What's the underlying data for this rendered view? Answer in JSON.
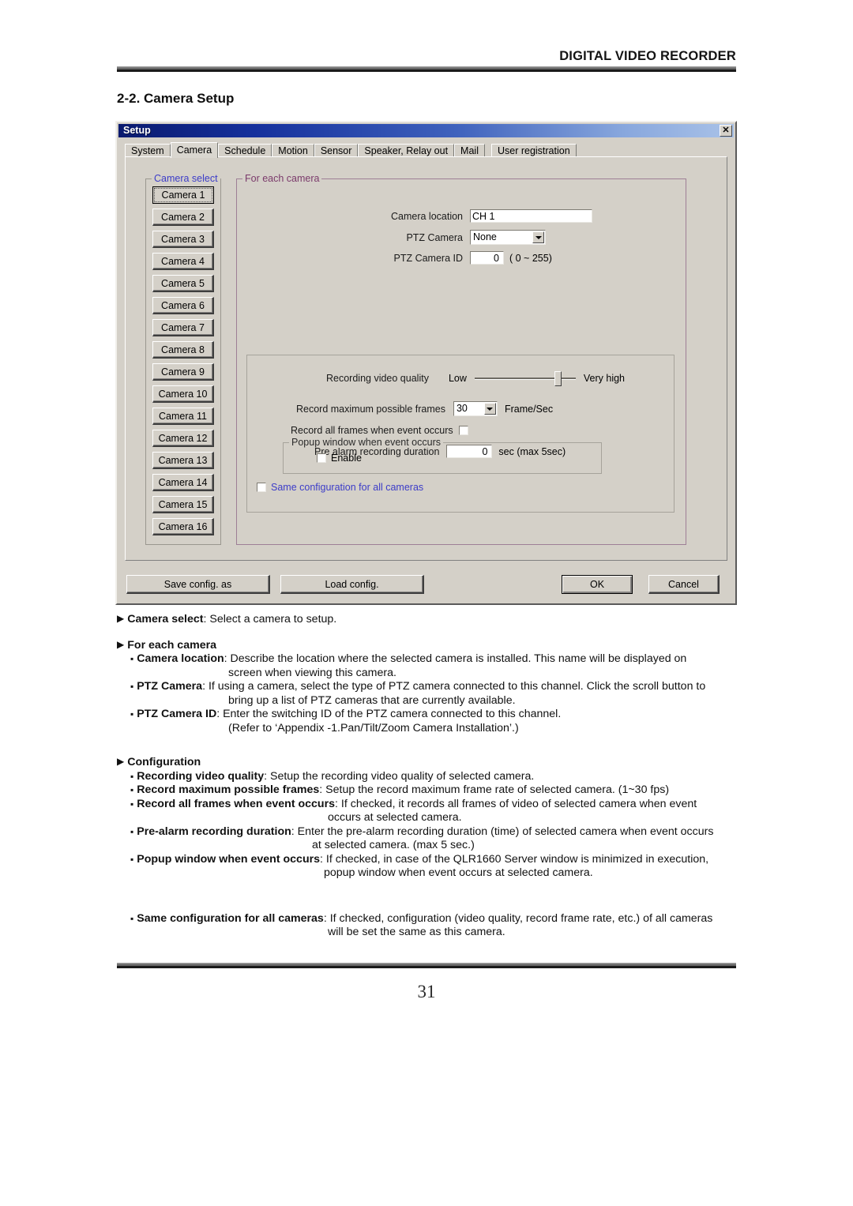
{
  "header": {
    "title": "DIGITAL VIDEO RECORDER"
  },
  "section": {
    "title": "2-2. Camera Setup"
  },
  "dialog": {
    "title": "Setup",
    "close_label": "✕",
    "tabs": [
      {
        "label": "System",
        "selected": false
      },
      {
        "label": "Camera",
        "selected": true
      },
      {
        "label": "Schedule",
        "selected": false
      },
      {
        "label": "Motion",
        "selected": false
      },
      {
        "label": "Sensor",
        "selected": false
      },
      {
        "label": "Speaker, Relay out",
        "selected": false
      },
      {
        "label": "Mail",
        "selected": false
      },
      {
        "label": "User registration",
        "selected": false
      }
    ],
    "camera_select": {
      "legend": "Camera select",
      "selected_index": 0,
      "cameras": [
        "Camera 1",
        "Camera 2",
        "Camera 3",
        "Camera 4",
        "Camera 5",
        "Camera 6",
        "Camera 7",
        "Camera 8",
        "Camera 9",
        "Camera 10",
        "Camera 11",
        "Camera 12",
        "Camera 13",
        "Camera 14",
        "Camera 15",
        "Camera 16"
      ]
    },
    "for_each_camera": {
      "legend": "For each camera",
      "camera_location_label": "Camera location",
      "camera_location_value": "CH 1",
      "ptz_camera_label": "PTZ Camera",
      "ptz_camera_value": "None",
      "ptz_camera_id_label": "PTZ Camera ID",
      "ptz_camera_id_value": "0",
      "ptz_camera_id_range": "( 0 ~ 255)"
    },
    "configuration": {
      "quality_label": "Recording video quality",
      "quality_min_label": "Low",
      "quality_max_label": "Very high",
      "quality_position_percent": 79,
      "max_frames_label": "Record maximum possible frames",
      "max_frames_value": "30",
      "max_frames_unit": "Frame/Sec",
      "record_all_frames_label": "Record all frames when event occurs",
      "record_all_frames_checked": false,
      "pre_alarm_label": "Pre alarm recording duration",
      "pre_alarm_value": "0",
      "pre_alarm_unit": "sec (max 5sec)",
      "popup_legend": "Popup window when event occurs",
      "popup_enable_label": "Enable",
      "popup_enable_checked": false,
      "same_config_label": "Same configuration for all cameras",
      "same_config_checked": false
    },
    "buttons": {
      "save_config_as": "Save config. as",
      "load_config": "Load config.",
      "ok": "OK",
      "cancel": "Cancel"
    }
  },
  "description": {
    "camera_select_term": "Camera select",
    "camera_select_text": ": Select a camera to setup.",
    "for_each_camera_heading": "For each camera",
    "camera_location_term": "Camera location",
    "camera_location_text": ": Describe the location where the selected camera is installed. This name will be displayed on",
    "camera_location_cont": "screen when viewing this camera.",
    "ptz_camera_term": "PTZ Camera",
    "ptz_camera_text": ": If using a camera, select the type of PTZ camera connected to this channel. Click the scroll button to",
    "ptz_camera_cont": "bring up a list of PTZ cameras that are currently available.",
    "ptz_camera_id_term": "PTZ Camera ID",
    "ptz_camera_id_text": ": Enter the switching ID of the PTZ camera connected to this channel.",
    "ptz_camera_id_cont": "(Refer to ‘Appendix -1.Pan/Tilt/Zoom Camera Installation’.)",
    "configuration_heading": "Configuration",
    "recording_quality_term": "Recording video quality",
    "recording_quality_text": ": Setup the recording video quality of selected camera.",
    "max_frames_term": "Record maximum possible frames",
    "max_frames_text": ": Setup the record maximum frame rate of selected camera. (1~30 fps)",
    "record_all_term": "Record all frames when event occurs",
    "record_all_text": ": If checked, it records all frames of video of selected camera when event",
    "record_all_cont": "occurs at selected camera.",
    "pre_alarm_term": "Pre-alarm recording duration",
    "pre_alarm_text": ": Enter the pre-alarm recording duration (time) of selected camera when event occurs",
    "pre_alarm_cont": "at selected camera. (max 5 sec.)",
    "popup_term": "Popup window when event occurs",
    "popup_text": ": If checked, in case of the QLR1660 Server window is minimized in execution,",
    "popup_cont": "popup window when event occurs at selected camera.",
    "same_config_term": "Same configuration for all cameras",
    "same_config_text": ": If checked, configuration (video quality, record frame rate, etc.) of all cameras",
    "same_config_cont": "will be set the same as this camera."
  },
  "footer": {
    "page_number": "31"
  }
}
